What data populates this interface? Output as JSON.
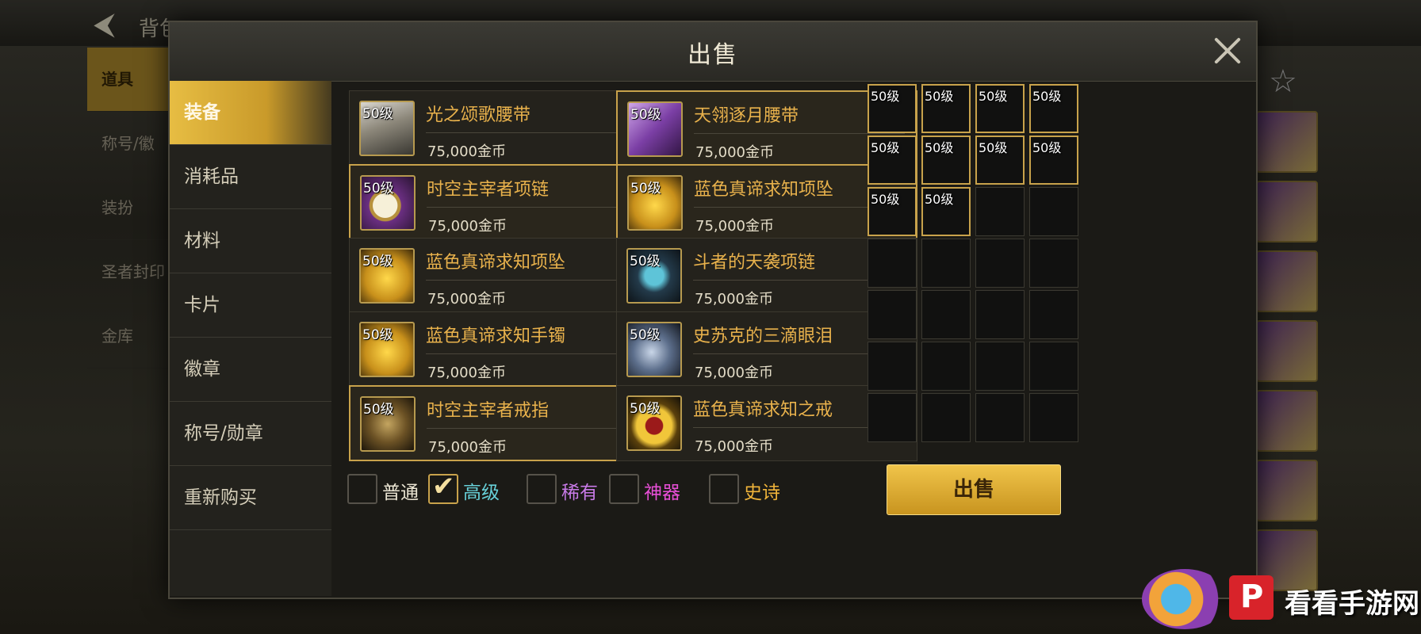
{
  "background": {
    "title": "背包",
    "left_tabs": [
      "道具",
      "称号/徽",
      "装扮",
      "圣者封印",
      "金库"
    ]
  },
  "dialog": {
    "title": "出售",
    "categories": [
      {
        "label": "装备",
        "active": true
      },
      {
        "label": "消耗品",
        "active": false
      },
      {
        "label": "材料",
        "active": false
      },
      {
        "label": "卡片",
        "active": false
      },
      {
        "label": "徽章",
        "active": false
      },
      {
        "label": "称号/勋章",
        "active": false
      },
      {
        "label": "重新购买",
        "active": false
      }
    ],
    "items": [
      {
        "level": "50级",
        "name": "光之颂歌腰带",
        "price": "75,000金币",
        "selected": false,
        "icon": "belt-icon",
        "art": "art-belt"
      },
      {
        "level": "50级",
        "name": "天翎逐月腰带",
        "price": "75,000金币",
        "selected": true,
        "icon": "sash-icon",
        "art": "art-sash"
      },
      {
        "level": "50级",
        "name": "时空主宰者项链",
        "price": "75,000金币",
        "selected": true,
        "icon": "clock-necklace-icon",
        "art": "art-clock"
      },
      {
        "level": "50级",
        "name": "蓝色真谛求知项坠",
        "price": "75,000金币",
        "selected": true,
        "icon": "gold-pendant-icon",
        "art": "art-gold"
      },
      {
        "level": "50级",
        "name": "蓝色真谛求知项坠",
        "price": "75,000金币",
        "selected": false,
        "icon": "gold-pendant-icon",
        "art": "art-gold"
      },
      {
        "level": "50级",
        "name": "斗者的天袭项链",
        "price": "75,000金币",
        "selected": false,
        "icon": "mask-necklace-icon",
        "art": "art-mask"
      },
      {
        "level": "50级",
        "name": "蓝色真谛求知手镯",
        "price": "75,000金币",
        "selected": false,
        "icon": "gold-bracelet-icon",
        "art": "art-gold"
      },
      {
        "level": "50级",
        "name": "史苏克的三滴眼泪",
        "price": "75,000金币",
        "selected": false,
        "icon": "chain-icon",
        "art": "art-chain"
      },
      {
        "level": "50级",
        "name": "时空主宰者戒指",
        "price": "75,000金币",
        "selected": true,
        "icon": "dark-ring-icon",
        "art": "art-ringdark"
      },
      {
        "level": "50级",
        "name": "蓝色真谛求知之戒",
        "price": "75,000金币",
        "selected": false,
        "icon": "ruby-ring-icon",
        "art": "art-ring"
      }
    ],
    "filters": [
      {
        "label": "普通",
        "checked": false,
        "color": "#ece6d4"
      },
      {
        "label": "高级",
        "checked": true,
        "color": "#67d0d8"
      },
      {
        "label": "稀有",
        "checked": false,
        "color": "#c97be8"
      },
      {
        "label": "神器",
        "checked": false,
        "color": "#e94fd8"
      },
      {
        "label": "史诗",
        "checked": false,
        "color": "#f0b43a"
      }
    ],
    "sell_slots": [
      {
        "level": "50级",
        "icon": "pants-icon",
        "art": "art-pants"
      },
      {
        "level": "50级",
        "icon": "pants-icon",
        "art": "art-pants"
      },
      {
        "level": "50级",
        "icon": "sash-icon",
        "art": "art-sash"
      },
      {
        "level": "50级",
        "icon": "belt-icon",
        "art": "art-belt"
      },
      {
        "level": "50级",
        "icon": "dark-ring-icon",
        "art": "art-ringdark"
      },
      {
        "level": "50级",
        "icon": "clock-necklace-icon",
        "art": "art-clock"
      },
      {
        "level": "50级",
        "icon": "sash-icon",
        "art": "art-sash"
      },
      {
        "level": "50级",
        "icon": "boot-icon",
        "art": "art-sash"
      },
      {
        "level": "50级",
        "icon": "boot-icon",
        "art": "art-sash"
      },
      {
        "level": "50级",
        "icon": "gold-pendant-icon",
        "art": "art-gold"
      }
    ],
    "sell_button": "出售"
  },
  "watermark": {
    "text": "看看手游网"
  },
  "colors": {
    "accent_gold": "#c8a24b",
    "item_name": "#e9b24c",
    "button": "#e4b43a"
  }
}
